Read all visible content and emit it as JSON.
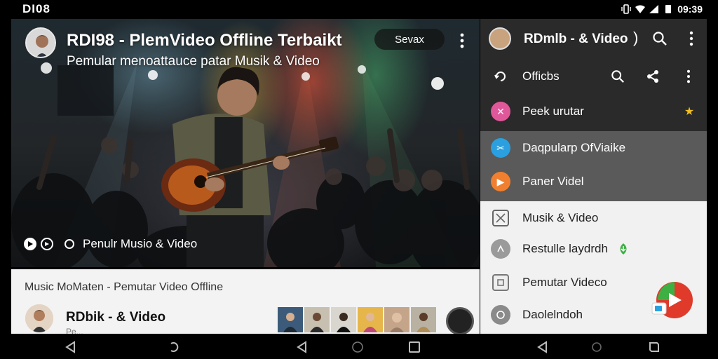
{
  "status_bar": {
    "left_text": "DI08",
    "time": "09:39"
  },
  "video": {
    "title": "RDI98 - PlemVideo Offline Terbaikt",
    "subtitle": "Pemular menoattauce patar Musik & Video",
    "save_label": "Sevax",
    "caption": "Penulr Musio & Video"
  },
  "card": {
    "title": "Music MoMaten - Pemutar Video Offline",
    "channel": "RDbik - & Video",
    "channel_sub": "Pe..."
  },
  "side_panel": {
    "header_title": "RDmlb - & Video",
    "items": [
      {
        "label": "Officbs",
        "icon": "refresh-icon"
      },
      {
        "label": "Peek urutar",
        "icon": "shuffle-icon",
        "color": "#e0589a"
      },
      {
        "label": "Daqpularp OfViaike",
        "icon": "crop-icon",
        "color": "#2aa0e0"
      },
      {
        "label": "Paner Videl",
        "icon": "play-icon",
        "color": "#f08030"
      },
      {
        "label": "Musik & Video",
        "icon": "image-icon"
      },
      {
        "label": "Restulle laydrdh",
        "icon": "timer-icon"
      },
      {
        "label": "Pemutar Videco",
        "icon": "screen-icon"
      },
      {
        "label": "Daolelndoh",
        "icon": "disc-icon"
      }
    ]
  },
  "colors": {
    "accent_star": "#f0c020",
    "badge_green": "#3cb043",
    "fab_red": "#e03a2a"
  }
}
